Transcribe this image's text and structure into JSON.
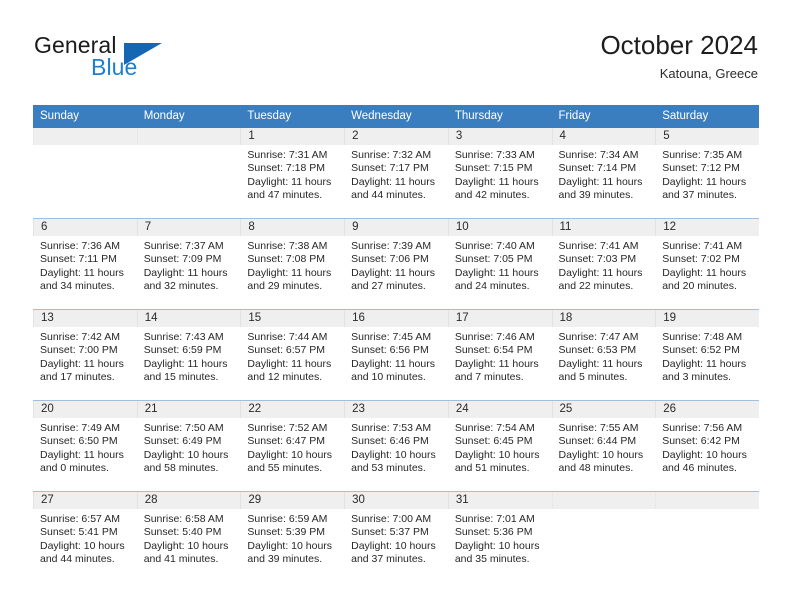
{
  "branding": {
    "name_primary": "General",
    "name_secondary": "Blue",
    "triangle_icon": "triangle-icon"
  },
  "header": {
    "title": "October 2024",
    "subtitle": "Katouna, Greece"
  },
  "colors": {
    "header_blue": "#3b7ebf",
    "logo_blue": "#1b7fd4",
    "daynum_band": "#efefef",
    "grid_line": "#9fbfdc"
  },
  "weekday_headers": [
    "Sunday",
    "Monday",
    "Tuesday",
    "Wednesday",
    "Thursday",
    "Friday",
    "Saturday"
  ],
  "weeks": [
    [
      {
        "day": "",
        "sunrise": "",
        "sunset": "",
        "daylight_line1": "",
        "daylight_line2": ""
      },
      {
        "day": "",
        "sunrise": "",
        "sunset": "",
        "daylight_line1": "",
        "daylight_line2": ""
      },
      {
        "day": "1",
        "sunrise": "Sunrise: 7:31 AM",
        "sunset": "Sunset: 7:18 PM",
        "daylight_line1": "Daylight: 11 hours",
        "daylight_line2": "and 47 minutes."
      },
      {
        "day": "2",
        "sunrise": "Sunrise: 7:32 AM",
        "sunset": "Sunset: 7:17 PM",
        "daylight_line1": "Daylight: 11 hours",
        "daylight_line2": "and 44 minutes."
      },
      {
        "day": "3",
        "sunrise": "Sunrise: 7:33 AM",
        "sunset": "Sunset: 7:15 PM",
        "daylight_line1": "Daylight: 11 hours",
        "daylight_line2": "and 42 minutes."
      },
      {
        "day": "4",
        "sunrise": "Sunrise: 7:34 AM",
        "sunset": "Sunset: 7:14 PM",
        "daylight_line1": "Daylight: 11 hours",
        "daylight_line2": "and 39 minutes."
      },
      {
        "day": "5",
        "sunrise": "Sunrise: 7:35 AM",
        "sunset": "Sunset: 7:12 PM",
        "daylight_line1": "Daylight: 11 hours",
        "daylight_line2": "and 37 minutes."
      }
    ],
    [
      {
        "day": "6",
        "sunrise": "Sunrise: 7:36 AM",
        "sunset": "Sunset: 7:11 PM",
        "daylight_line1": "Daylight: 11 hours",
        "daylight_line2": "and 34 minutes."
      },
      {
        "day": "7",
        "sunrise": "Sunrise: 7:37 AM",
        "sunset": "Sunset: 7:09 PM",
        "daylight_line1": "Daylight: 11 hours",
        "daylight_line2": "and 32 minutes."
      },
      {
        "day": "8",
        "sunrise": "Sunrise: 7:38 AM",
        "sunset": "Sunset: 7:08 PM",
        "daylight_line1": "Daylight: 11 hours",
        "daylight_line2": "and 29 minutes."
      },
      {
        "day": "9",
        "sunrise": "Sunrise: 7:39 AM",
        "sunset": "Sunset: 7:06 PM",
        "daylight_line1": "Daylight: 11 hours",
        "daylight_line2": "and 27 minutes."
      },
      {
        "day": "10",
        "sunrise": "Sunrise: 7:40 AM",
        "sunset": "Sunset: 7:05 PM",
        "daylight_line1": "Daylight: 11 hours",
        "daylight_line2": "and 24 minutes."
      },
      {
        "day": "11",
        "sunrise": "Sunrise: 7:41 AM",
        "sunset": "Sunset: 7:03 PM",
        "daylight_line1": "Daylight: 11 hours",
        "daylight_line2": "and 22 minutes."
      },
      {
        "day": "12",
        "sunrise": "Sunrise: 7:41 AM",
        "sunset": "Sunset: 7:02 PM",
        "daylight_line1": "Daylight: 11 hours",
        "daylight_line2": "and 20 minutes."
      }
    ],
    [
      {
        "day": "13",
        "sunrise": "Sunrise: 7:42 AM",
        "sunset": "Sunset: 7:00 PM",
        "daylight_line1": "Daylight: 11 hours",
        "daylight_line2": "and 17 minutes."
      },
      {
        "day": "14",
        "sunrise": "Sunrise: 7:43 AM",
        "sunset": "Sunset: 6:59 PM",
        "daylight_line1": "Daylight: 11 hours",
        "daylight_line2": "and 15 minutes."
      },
      {
        "day": "15",
        "sunrise": "Sunrise: 7:44 AM",
        "sunset": "Sunset: 6:57 PM",
        "daylight_line1": "Daylight: 11 hours",
        "daylight_line2": "and 12 minutes."
      },
      {
        "day": "16",
        "sunrise": "Sunrise: 7:45 AM",
        "sunset": "Sunset: 6:56 PM",
        "daylight_line1": "Daylight: 11 hours",
        "daylight_line2": "and 10 minutes."
      },
      {
        "day": "17",
        "sunrise": "Sunrise: 7:46 AM",
        "sunset": "Sunset: 6:54 PM",
        "daylight_line1": "Daylight: 11 hours",
        "daylight_line2": "and 7 minutes."
      },
      {
        "day": "18",
        "sunrise": "Sunrise: 7:47 AM",
        "sunset": "Sunset: 6:53 PM",
        "daylight_line1": "Daylight: 11 hours",
        "daylight_line2": "and 5 minutes."
      },
      {
        "day": "19",
        "sunrise": "Sunrise: 7:48 AM",
        "sunset": "Sunset: 6:52 PM",
        "daylight_line1": "Daylight: 11 hours",
        "daylight_line2": "and 3 minutes."
      }
    ],
    [
      {
        "day": "20",
        "sunrise": "Sunrise: 7:49 AM",
        "sunset": "Sunset: 6:50 PM",
        "daylight_line1": "Daylight: 11 hours",
        "daylight_line2": "and 0 minutes."
      },
      {
        "day": "21",
        "sunrise": "Sunrise: 7:50 AM",
        "sunset": "Sunset: 6:49 PM",
        "daylight_line1": "Daylight: 10 hours",
        "daylight_line2": "and 58 minutes."
      },
      {
        "day": "22",
        "sunrise": "Sunrise: 7:52 AM",
        "sunset": "Sunset: 6:47 PM",
        "daylight_line1": "Daylight: 10 hours",
        "daylight_line2": "and 55 minutes."
      },
      {
        "day": "23",
        "sunrise": "Sunrise: 7:53 AM",
        "sunset": "Sunset: 6:46 PM",
        "daylight_line1": "Daylight: 10 hours",
        "daylight_line2": "and 53 minutes."
      },
      {
        "day": "24",
        "sunrise": "Sunrise: 7:54 AM",
        "sunset": "Sunset: 6:45 PM",
        "daylight_line1": "Daylight: 10 hours",
        "daylight_line2": "and 51 minutes."
      },
      {
        "day": "25",
        "sunrise": "Sunrise: 7:55 AM",
        "sunset": "Sunset: 6:44 PM",
        "daylight_line1": "Daylight: 10 hours",
        "daylight_line2": "and 48 minutes."
      },
      {
        "day": "26",
        "sunrise": "Sunrise: 7:56 AM",
        "sunset": "Sunset: 6:42 PM",
        "daylight_line1": "Daylight: 10 hours",
        "daylight_line2": "and 46 minutes."
      }
    ],
    [
      {
        "day": "27",
        "sunrise": "Sunrise: 6:57 AM",
        "sunset": "Sunset: 5:41 PM",
        "daylight_line1": "Daylight: 10 hours",
        "daylight_line2": "and 44 minutes."
      },
      {
        "day": "28",
        "sunrise": "Sunrise: 6:58 AM",
        "sunset": "Sunset: 5:40 PM",
        "daylight_line1": "Daylight: 10 hours",
        "daylight_line2": "and 41 minutes."
      },
      {
        "day": "29",
        "sunrise": "Sunrise: 6:59 AM",
        "sunset": "Sunset: 5:39 PM",
        "daylight_line1": "Daylight: 10 hours",
        "daylight_line2": "and 39 minutes."
      },
      {
        "day": "30",
        "sunrise": "Sunrise: 7:00 AM",
        "sunset": "Sunset: 5:37 PM",
        "daylight_line1": "Daylight: 10 hours",
        "daylight_line2": "and 37 minutes."
      },
      {
        "day": "31",
        "sunrise": "Sunrise: 7:01 AM",
        "sunset": "Sunset: 5:36 PM",
        "daylight_line1": "Daylight: 10 hours",
        "daylight_line2": "and 35 minutes."
      },
      {
        "day": "",
        "sunrise": "",
        "sunset": "",
        "daylight_line1": "",
        "daylight_line2": ""
      },
      {
        "day": "",
        "sunrise": "",
        "sunset": "",
        "daylight_line1": "",
        "daylight_line2": ""
      }
    ]
  ]
}
